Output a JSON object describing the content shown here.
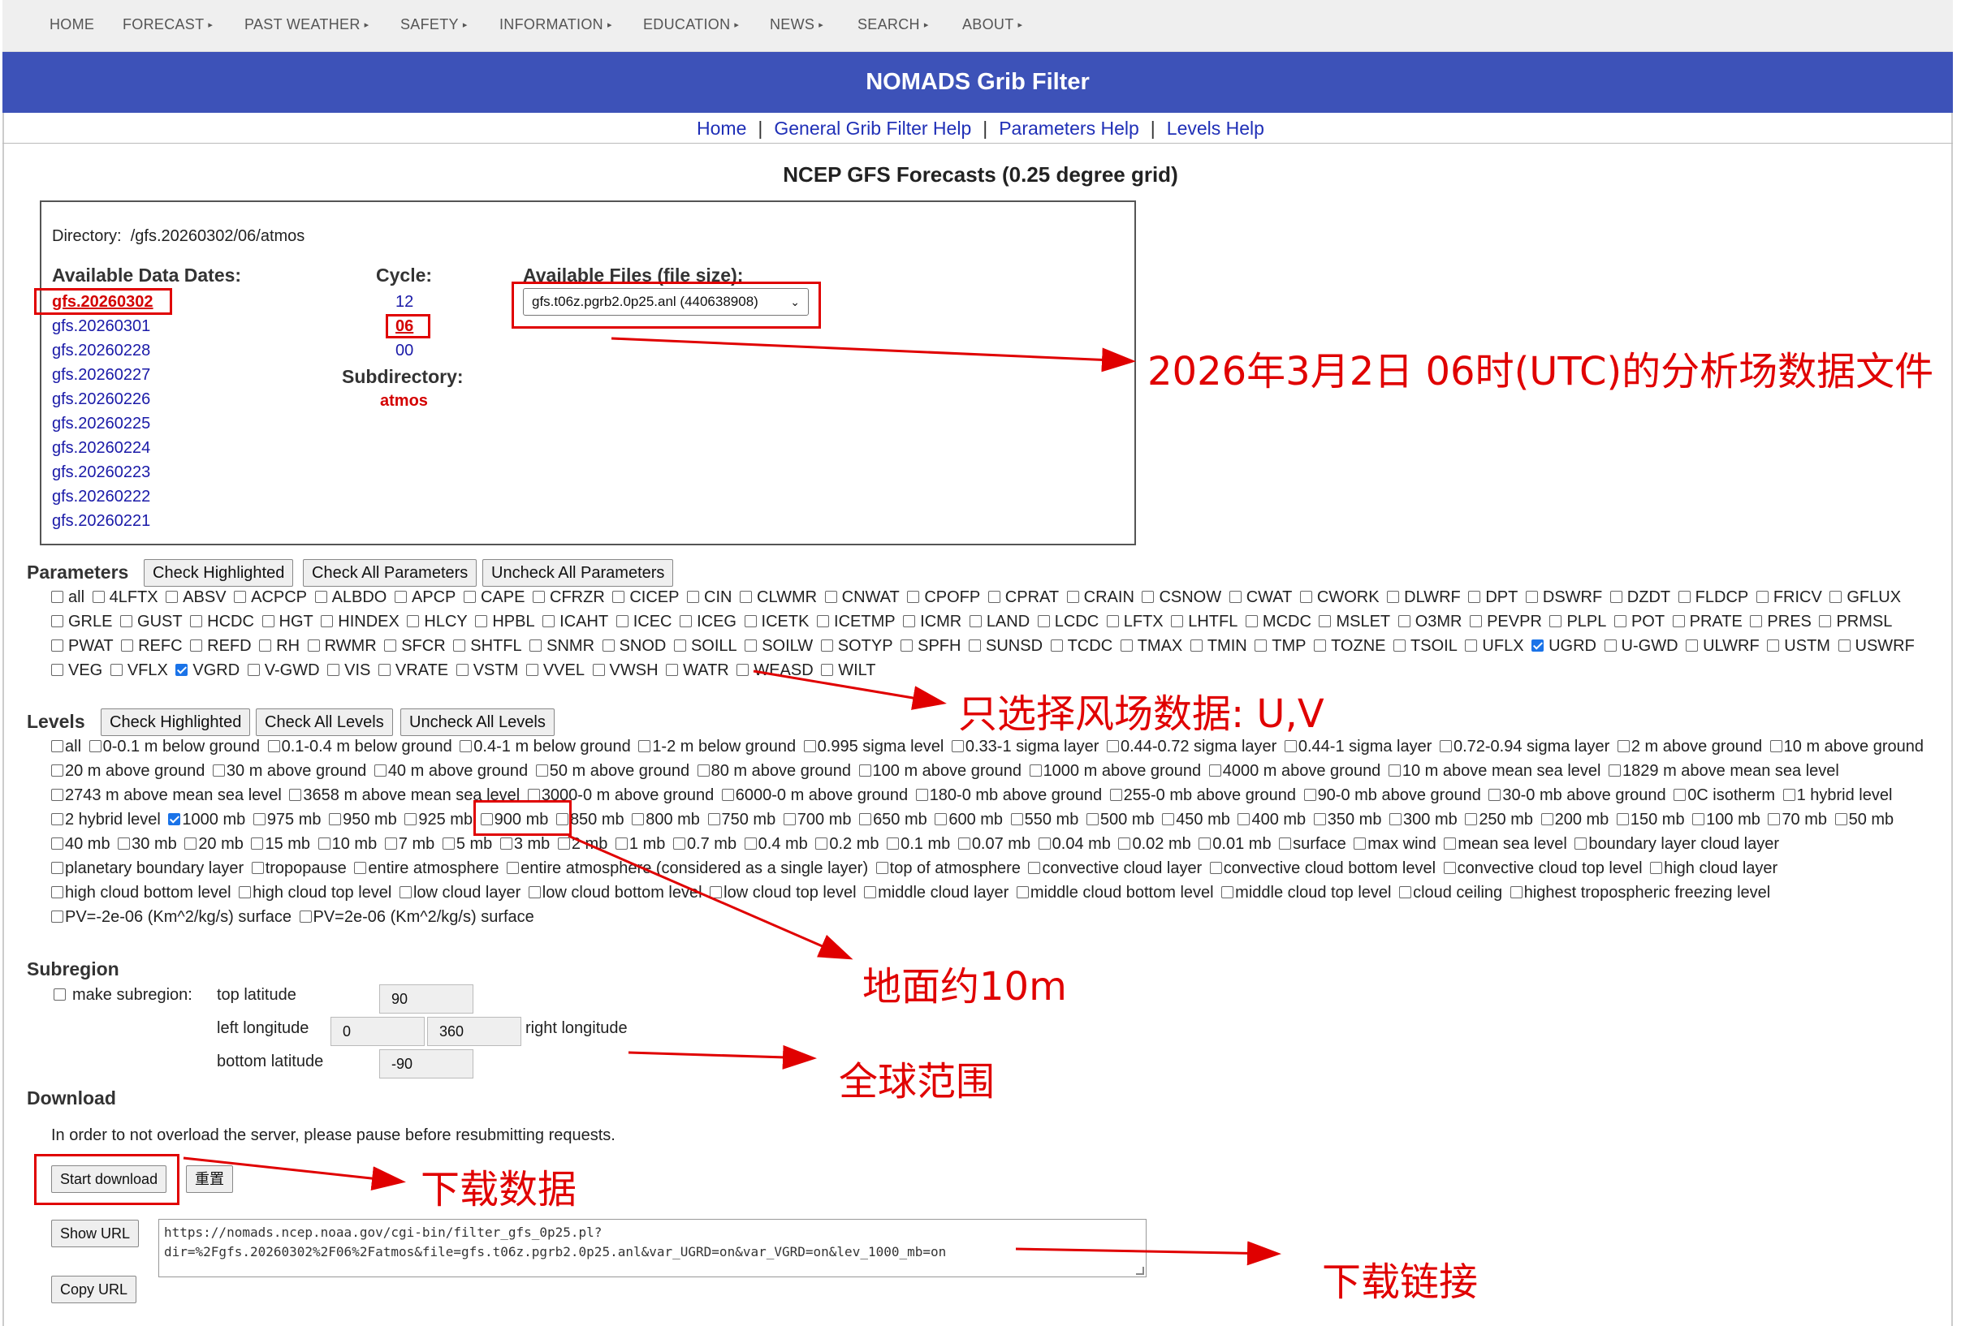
{
  "nav": [
    {
      "label": "HOME",
      "caret": false
    },
    {
      "label": "FORECAST",
      "caret": true
    },
    {
      "label": "PAST WEATHER",
      "caret": true
    },
    {
      "label": "SAFETY",
      "caret": true
    },
    {
      "label": "INFORMATION",
      "caret": true
    },
    {
      "label": "EDUCATION",
      "caret": true
    },
    {
      "label": "NEWS",
      "caret": true
    },
    {
      "label": "SEARCH",
      "caret": true
    },
    {
      "label": "ABOUT",
      "caret": true
    }
  ],
  "banner": "NOMADS Grib Filter",
  "help_links": [
    "Home",
    "General Grib Filter Help",
    "Parameters Help",
    "Levels Help"
  ],
  "help_sep": "|",
  "title": "NCEP GFS Forecasts (0.25 degree grid)",
  "directory": {
    "label": "Directory:",
    "path": "/gfs.20260302/06/atmos",
    "dates_label": "Available Data Dates:",
    "dates": [
      "gfs.20260302",
      "gfs.20260301",
      "gfs.20260228",
      "gfs.20260227",
      "gfs.20260226",
      "gfs.20260225",
      "gfs.20260224",
      "gfs.20260223",
      "gfs.20260222",
      "gfs.20260221"
    ],
    "active_date": "gfs.20260302",
    "cycle_label": "Cycle:",
    "cycles": [
      "12",
      "06",
      "00"
    ],
    "active_cycle": "06",
    "subdir_label": "Subdirectory:",
    "subdir": "atmos",
    "files_label": "Available Files (file size):",
    "selected_file": "gfs.t06z.pgrb2.0p25.anl (440638908)"
  },
  "parameters": {
    "heading": "Parameters",
    "buttons": [
      "Check Highlighted",
      "Check All Parameters",
      "Uncheck All Parameters"
    ],
    "options": [
      "all",
      "4LFTX",
      "ABSV",
      "ACPCP",
      "ALBDO",
      "APCP",
      "CAPE",
      "CFRZR",
      "CICEP",
      "CIN",
      "CLWMR",
      "CNWAT",
      "CPOFP",
      "CPRAT",
      "CRAIN",
      "CSNOW",
      "CWAT",
      "CWORK",
      "DLWRF",
      "DPT",
      "DSWRF",
      "DZDT",
      "FLDCP",
      "FRICV",
      "GFLUX",
      "GRLE",
      "GUST",
      "HCDC",
      "HGT",
      "HINDEX",
      "HLCY",
      "HPBL",
      "ICAHT",
      "ICEC",
      "ICEG",
      "ICETK",
      "ICETMP",
      "ICMR",
      "LAND",
      "LCDC",
      "LFTX",
      "LHTFL",
      "MCDC",
      "MSLET",
      "O3MR",
      "PEVPR",
      "PLPL",
      "POT",
      "PRATE",
      "PRES",
      "PRMSL",
      "PWAT",
      "REFC",
      "REFD",
      "RH",
      "RWMR",
      "SFCR",
      "SHTFL",
      "SNMR",
      "SNOD",
      "SOILL",
      "SOILW",
      "SOTYP",
      "SPFH",
      "SUNSD",
      "TCDC",
      "TMAX",
      "TMIN",
      "TMP",
      "TOZNE",
      "TSOIL",
      "UFLX",
      "UGRD",
      "U-GWD",
      "ULWRF",
      "USTM",
      "USWRF",
      "VEG",
      "VFLX",
      "VGRD",
      "V-GWD",
      "VIS",
      "VRATE",
      "VSTM",
      "VVEL",
      "VWSH",
      "WATR",
      "WEASD",
      "WILT"
    ],
    "checked": [
      "UGRD",
      "VGRD"
    ]
  },
  "levels": {
    "heading": "Levels",
    "buttons": [
      "Check Highlighted",
      "Check All Levels",
      "Uncheck All Levels"
    ],
    "options": [
      "all",
      "0-0.1 m below ground",
      "0.1-0.4 m below ground",
      "0.4-1 m below ground",
      "1-2 m below ground",
      "0.995 sigma level",
      "0.33-1 sigma layer",
      "0.44-0.72 sigma layer",
      "0.44-1 sigma layer",
      "0.72-0.94 sigma layer",
      "2 m above ground",
      "10 m above ground",
      "20 m above ground",
      "30 m above ground",
      "40 m above ground",
      "50 m above ground",
      "80 m above ground",
      "100 m above ground",
      "1000 m above ground",
      "4000 m above ground",
      "10 m above mean sea level",
      "1829 m above mean sea level",
      "2743 m above mean sea level",
      "3658 m above mean sea level",
      "3000-0 m above ground",
      "6000-0 m above ground",
      "180-0 mb above ground",
      "255-0 mb above ground",
      "90-0 mb above ground",
      "30-0 mb above ground",
      "0C isotherm",
      "1 hybrid level",
      "2 hybrid level",
      "1000 mb",
      "975 mb",
      "950 mb",
      "925 mb",
      "900 mb",
      "850 mb",
      "800 mb",
      "750 mb",
      "700 mb",
      "650 mb",
      "600 mb",
      "550 mb",
      "500 mb",
      "450 mb",
      "400 mb",
      "350 mb",
      "300 mb",
      "250 mb",
      "200 mb",
      "150 mb",
      "100 mb",
      "70 mb",
      "50 mb",
      "40 mb",
      "30 mb",
      "20 mb",
      "15 mb",
      "10 mb",
      "7 mb",
      "5 mb",
      "3 mb",
      "2 mb",
      "1 mb",
      "0.7 mb",
      "0.4 mb",
      "0.2 mb",
      "0.1 mb",
      "0.07 mb",
      "0.04 mb",
      "0.02 mb",
      "0.01 mb",
      "surface",
      "max wind",
      "mean sea level",
      "boundary layer cloud layer",
      "planetary boundary layer",
      "tropopause",
      "entire atmosphere",
      "entire atmosphere (considered as a single layer)",
      "top of atmosphere",
      "convective cloud layer",
      "convective cloud bottom level",
      "convective cloud top level",
      "high cloud layer",
      "high cloud bottom level",
      "high cloud top level",
      "low cloud layer",
      "low cloud bottom level",
      "low cloud top level",
      "middle cloud layer",
      "middle cloud bottom level",
      "middle cloud top level",
      "cloud ceiling",
      "highest tropospheric freezing level",
      "PV=-2e-06 (Km^2/kg/s) surface",
      "PV=2e-06 (Km^2/kg/s) surface"
    ],
    "checked": [
      "1000 mb"
    ]
  },
  "subregion": {
    "heading": "Subregion",
    "make_label": "make subregion:",
    "top_label": "top latitude",
    "top_value": "90",
    "left_label": "left longitude",
    "left_value": "0",
    "right_value": "360",
    "right_label": "right longitude",
    "bottom_label": "bottom latitude",
    "bottom_value": "-90"
  },
  "download": {
    "heading": "Download",
    "note": "In order to not overload the server, please pause before resubmitting requests.",
    "start_button": "Start download",
    "reset_button": "重置",
    "show_url_button": "Show URL",
    "copy_url_button": "Copy URL",
    "url": "https://nomads.ncep.noaa.gov/cgi-bin/filter_gfs_0p25.pl?\ndir=%2Fgfs.20260302%2F06%2Fatmos&file=gfs.t06z.pgrb2.0p25.anl&var_UGRD=on&var_VGRD=on&lev_1000_mb=on"
  },
  "annotations": {
    "file_note": "2026年3月2日 06时(UTC)的分析场数据文件",
    "wind_note": "只选择风场数据: U,V",
    "level_note": "地面约10m",
    "region_note": "全球范围",
    "download_note": "下载数据",
    "link_note": "下载链接"
  },
  "colors": {
    "banner": "#3d52b8",
    "annotation": "#e00000",
    "link": "#1f2fb7"
  }
}
